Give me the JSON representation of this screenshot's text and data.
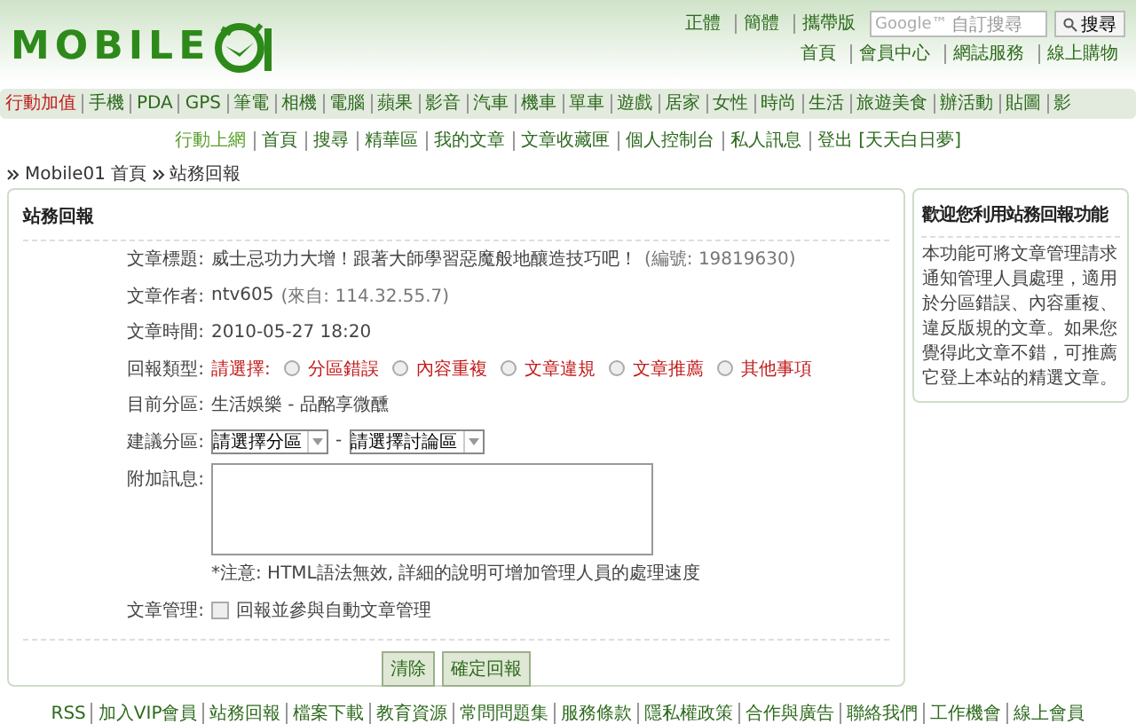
{
  "header": {
    "logo": "MOBILE",
    "language_links": [
      "正體",
      "簡體",
      "攜帶版"
    ],
    "search": {
      "brand": "Google™",
      "placeholder": "自訂搜尋",
      "button": "搜尋"
    },
    "site_links": [
      "首頁",
      "會員中心",
      "網誌服務",
      "線上購物"
    ]
  },
  "nav": [
    {
      "label": "行動加值",
      "selected": true
    },
    {
      "label": "手機",
      "selected": false
    },
    {
      "label": "PDA",
      "selected": false
    },
    {
      "label": "GPS",
      "selected": false
    },
    {
      "label": "筆電",
      "selected": false
    },
    {
      "label": "相機",
      "selected": false
    },
    {
      "label": "電腦",
      "selected": false
    },
    {
      "label": "蘋果",
      "selected": false
    },
    {
      "label": "影音",
      "selected": false
    },
    {
      "label": "汽車",
      "selected": false
    },
    {
      "label": "機車",
      "selected": false
    },
    {
      "label": "單車",
      "selected": false
    },
    {
      "label": "遊戲",
      "selected": false
    },
    {
      "label": "居家",
      "selected": false
    },
    {
      "label": "女性",
      "selected": false
    },
    {
      "label": "時尚",
      "selected": false
    },
    {
      "label": "生活",
      "selected": false
    },
    {
      "label": "旅遊美食",
      "selected": false
    },
    {
      "label": "辦活動",
      "selected": false
    },
    {
      "label": "貼圖",
      "selected": false
    },
    {
      "label": "影",
      "selected": false
    }
  ],
  "subnav": [
    {
      "label": "行動上網",
      "selected": true
    },
    {
      "label": "首頁",
      "selected": false
    },
    {
      "label": "搜尋",
      "selected": false
    },
    {
      "label": "精華區",
      "selected": false
    },
    {
      "label": "我的文章",
      "selected": false
    },
    {
      "label": "文章收藏匣",
      "selected": false
    },
    {
      "label": "個人控制台",
      "selected": false
    },
    {
      "label": "私人訊息",
      "selected": false
    },
    {
      "label": "登出 [天天白日夢]",
      "selected": false
    }
  ],
  "breadcrumb": [
    "Mobile01 首頁",
    "站務回報"
  ],
  "form": {
    "title": "站務回報",
    "fields": [
      {
        "label": "文章標題:",
        "value": "威士忌功力大增！跟著大師學習惡魔般地釀造技巧吧！",
        "extra": "(編號: 19819630)"
      },
      {
        "label": "文章作者:",
        "value": "ntv605",
        "extra": "(來自: 114.32.55.7)"
      },
      {
        "label": "文章時間:",
        "value": "2010-05-27 18:20"
      }
    ],
    "report_type": {
      "label": "回報類型:",
      "prompt": "請選擇:",
      "options": [
        {
          "label": "分區錯誤",
          "selected": false
        },
        {
          "label": "內容重複",
          "selected": false
        },
        {
          "label": "文章違規",
          "selected": false
        },
        {
          "label": "文章推薦",
          "selected": false
        },
        {
          "label": "其他事項",
          "selected": false
        }
      ]
    },
    "current_section": {
      "label": "目前分區:",
      "value": "生活娛樂 - 品酩享微醺"
    },
    "suggest": {
      "label": "建議分區:",
      "selects": [
        "請選擇分區",
        "請選擇討論區"
      ],
      "separator": "-"
    },
    "message": {
      "label": "附加訊息:",
      "note": "*注意: HTML語法無效, 詳細的說明可增加管理人員的處理速度"
    },
    "manage": {
      "label": "文章管理:",
      "checkbox": "回報並參與自動文章管理",
      "checked": false
    },
    "buttons": [
      "清除",
      "確定回報"
    ]
  },
  "sidebar": {
    "title": "歡迎您利用站務回報功能",
    "text": "本功能可將文章管理請求通知管理人員處理，適用於分區錯誤、內容重複、違反版規的文章。如果您覺得此文章不錯，可推薦它登上本站的精選文章。"
  },
  "footer": [
    "RSS",
    "加入VIP會員",
    "站務回報",
    "檔案下載",
    "教育資源",
    "常問問題集",
    "服務條款",
    "隱私權政策",
    "合作與廣告",
    "聯絡我們",
    "工作機會",
    "線上會員"
  ]
}
